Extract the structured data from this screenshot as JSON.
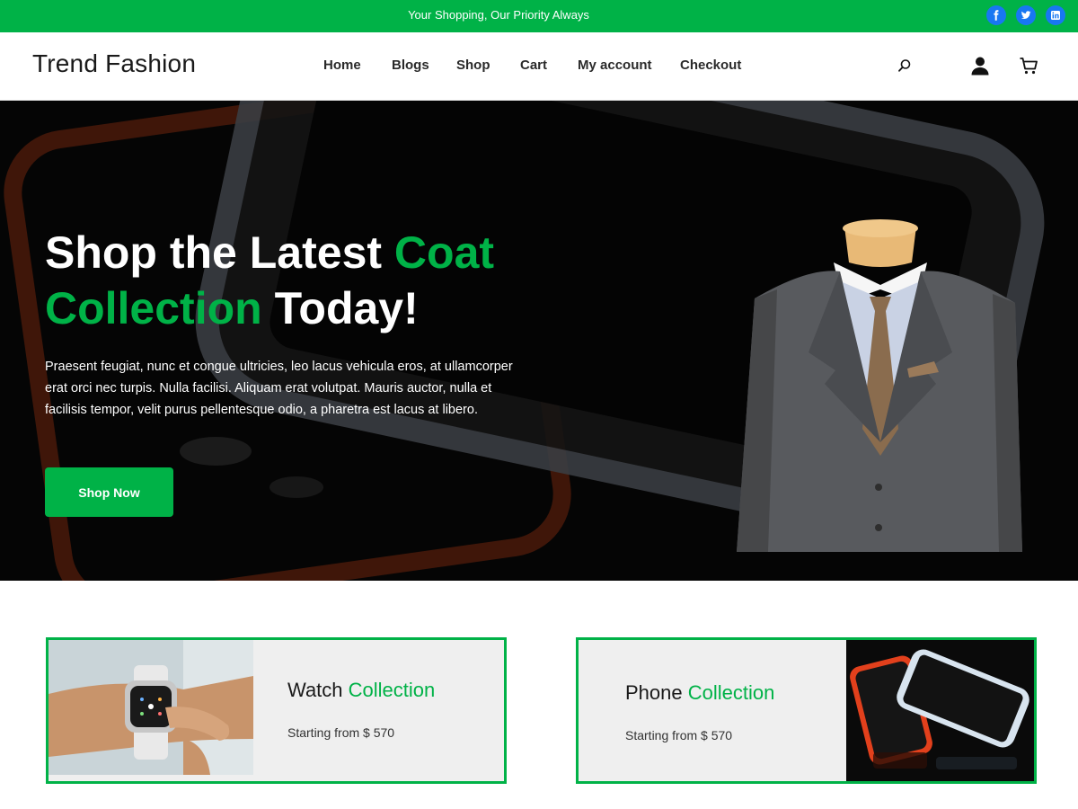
{
  "topbar": {
    "tagline": "Your Shopping, Our Priority Always",
    "social_icons": [
      "facebook-icon",
      "twitter-icon",
      "linkedin-icon"
    ]
  },
  "header": {
    "logo": "Trend Fashion",
    "nav": [
      "Home",
      "Blogs",
      "Shop",
      "Cart",
      "My account",
      "Checkout"
    ],
    "icons": [
      "search-icon",
      "user-icon",
      "cart-icon"
    ]
  },
  "hero": {
    "title_part1": "Shop the Latest ",
    "title_highlight1": "Coat",
    "title_highlight2": "Collection",
    "title_part2": " Today!",
    "description": "Praesent feugiat, nunc et congue ultricies, leo lacus vehicula eros, at ullamcorper erat orci nec turpis. Nulla facilisi. Aliquam erat volutpat. Mauris auctor, nulla et facilisis tempor, velit purus pellentesque odio, a pharetra est lacus at libero.",
    "button": "Shop Now"
  },
  "collections": [
    {
      "name": "Watch",
      "highlight": "Collection",
      "price": "Starting from $ 570"
    },
    {
      "name": "Phone",
      "highlight": "Collection",
      "price": "Starting from $ 570"
    }
  ],
  "colors": {
    "accent": "#00b247",
    "social": "#1877f2",
    "hero_bg": "#050505",
    "card_bg": "#efefef"
  }
}
